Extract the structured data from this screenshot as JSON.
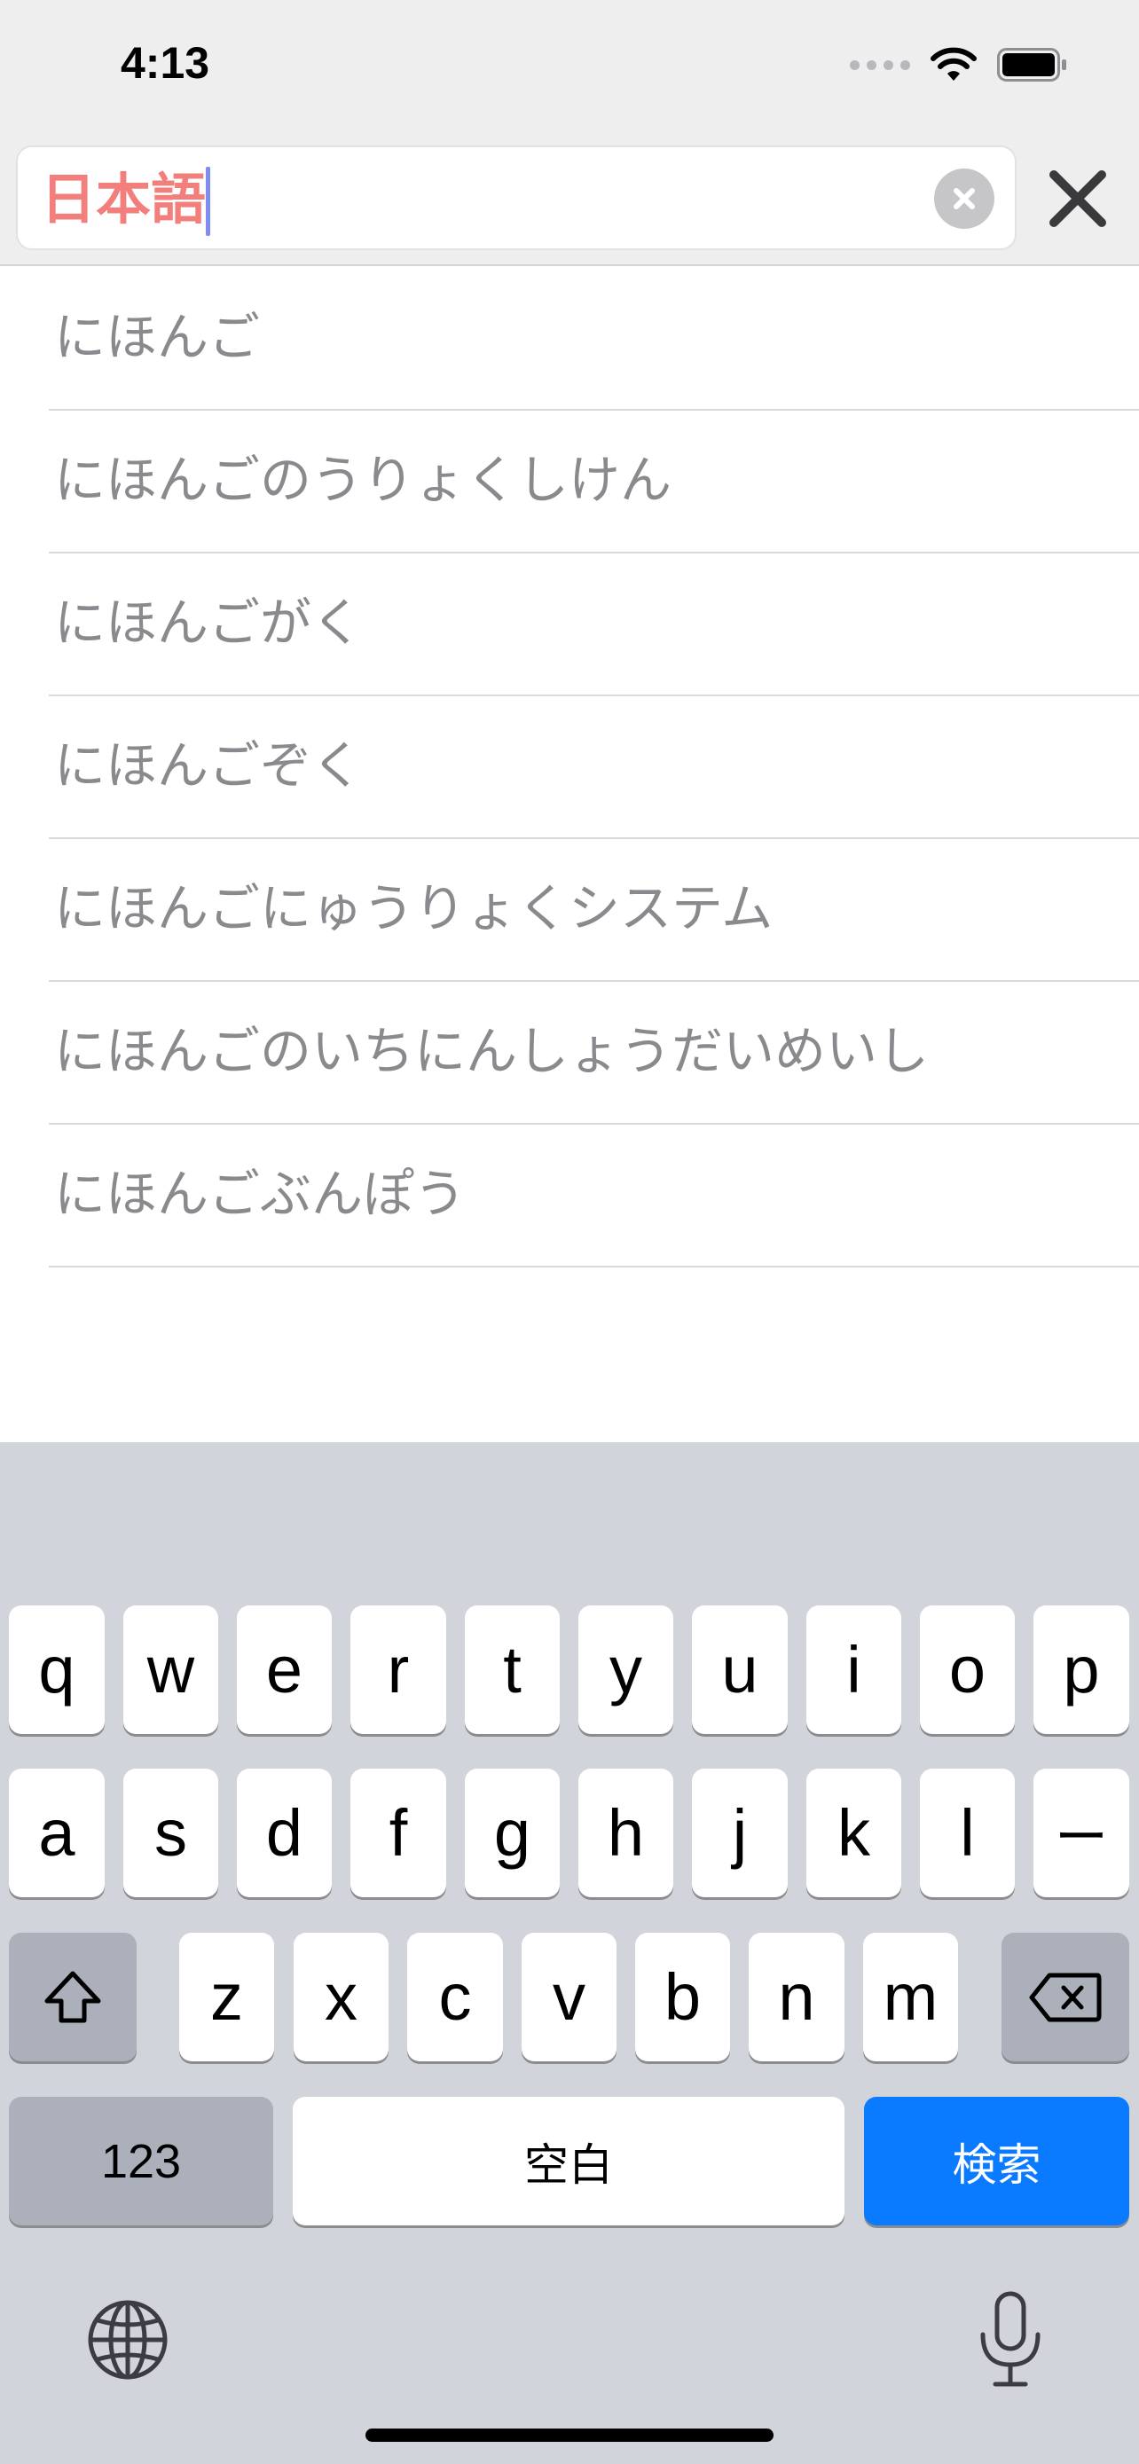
{
  "status_bar": {
    "time": "4:13"
  },
  "search": {
    "query": "日本語"
  },
  "suggestions": [
    "にほんご",
    "にほんごのうりょくしけん",
    "にほんごがく",
    "にほんごぞく",
    "にほんごにゅうりょくシステム",
    "にほんごのいちにんしょうだいめいし",
    "にほんごぶんぽう"
  ],
  "keyboard": {
    "row1": [
      "q",
      "w",
      "e",
      "r",
      "t",
      "y",
      "u",
      "i",
      "o",
      "p"
    ],
    "row2": [
      "a",
      "s",
      "d",
      "f",
      "g",
      "h",
      "j",
      "k",
      "l",
      "ー"
    ],
    "row3": [
      "z",
      "x",
      "c",
      "v",
      "b",
      "n",
      "m"
    ],
    "numbers_label": "123",
    "space_label": "空白",
    "search_label": "検索"
  },
  "colors": {
    "query_text": "#f27f7b",
    "search_key": "#0a7aff",
    "caret": "#7f8df0"
  }
}
